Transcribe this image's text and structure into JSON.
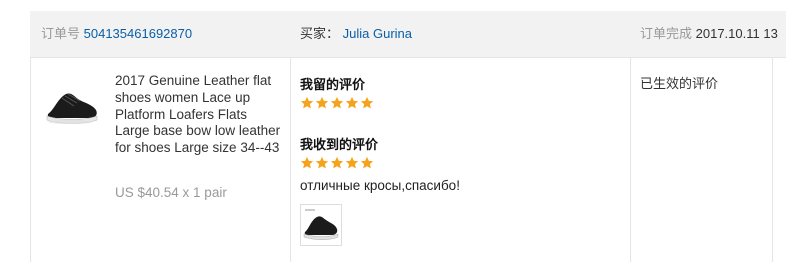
{
  "order": {
    "number_label": "订单号",
    "number": "504135461692870",
    "buyer_label": "买家：",
    "buyer_name": "Julia Gurina",
    "completed_label": "订单完成",
    "completed_date": "2017.10.11 13"
  },
  "product": {
    "title": "2017 Genuine Leather flat shoes women Lace up Platform Loafers Flats Large base bow low leather for shoes Large size 34--43",
    "price": "US $40.54 x 1 pair"
  },
  "feedback": {
    "my_feedback_label": "我留的评价",
    "my_rating": 5,
    "received_feedback_label": "我收到的评价",
    "received_rating": 5,
    "received_comment": "отличные кросы,спасибо!",
    "status": "已生效的评价"
  },
  "colors": {
    "star": "#f6a21a",
    "link": "#0a5ea8",
    "header_bg": "#f2f2f2",
    "muted": "#999999"
  },
  "icons": {
    "product": "sneaker-icon",
    "photo": "sneaker-photo-icon",
    "rating": "star-icon"
  }
}
